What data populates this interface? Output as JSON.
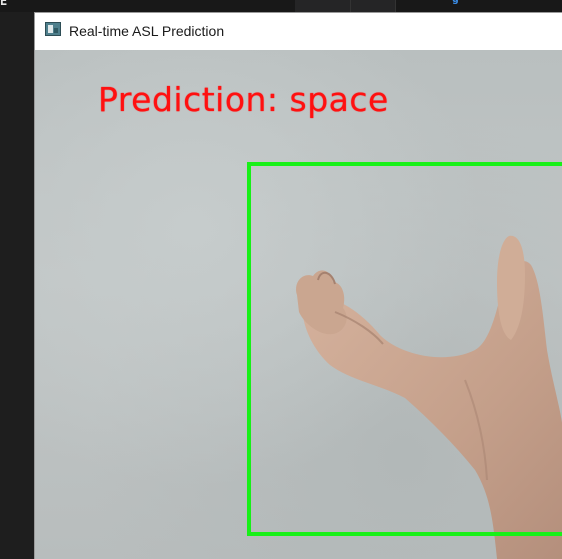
{
  "window": {
    "title": "Real-time ASL Prediction",
    "icon": "app-window-icon"
  },
  "background_editor": {
    "left_glyph": "E",
    "right_glyph": "g"
  },
  "video": {
    "prediction_text": "Prediction: space",
    "prediction_color": "#ff1010",
    "roi_box_color": "#18f018"
  }
}
